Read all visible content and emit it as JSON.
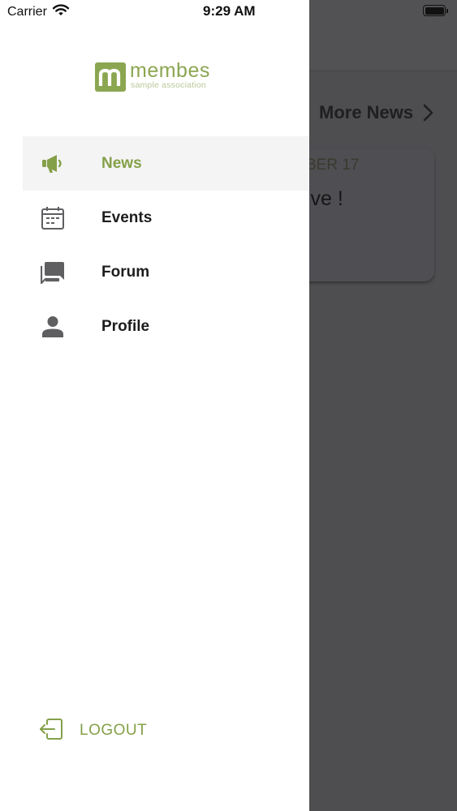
{
  "status_bar": {
    "carrier": "Carrier",
    "time": "9:29 AM"
  },
  "brand": {
    "logo_letter": "m",
    "logo_word": "membes",
    "logo_sub": "sample association"
  },
  "background": {
    "header_link": "More News",
    "card_date": "BER 17",
    "card_title": "ive !"
  },
  "menu": {
    "items": [
      {
        "label": "News",
        "icon": "megaphone-icon",
        "active": true
      },
      {
        "label": "Events",
        "icon": "calendar-icon",
        "active": false
      },
      {
        "label": "Forum",
        "icon": "chat-icon",
        "active": false
      },
      {
        "label": "Profile",
        "icon": "person-icon",
        "active": false
      }
    ],
    "logout_label": "LOGOUT"
  },
  "colors": {
    "accent": "#84a048",
    "icon_gray": "#5f5f62",
    "overlay": "#4e4d50"
  }
}
